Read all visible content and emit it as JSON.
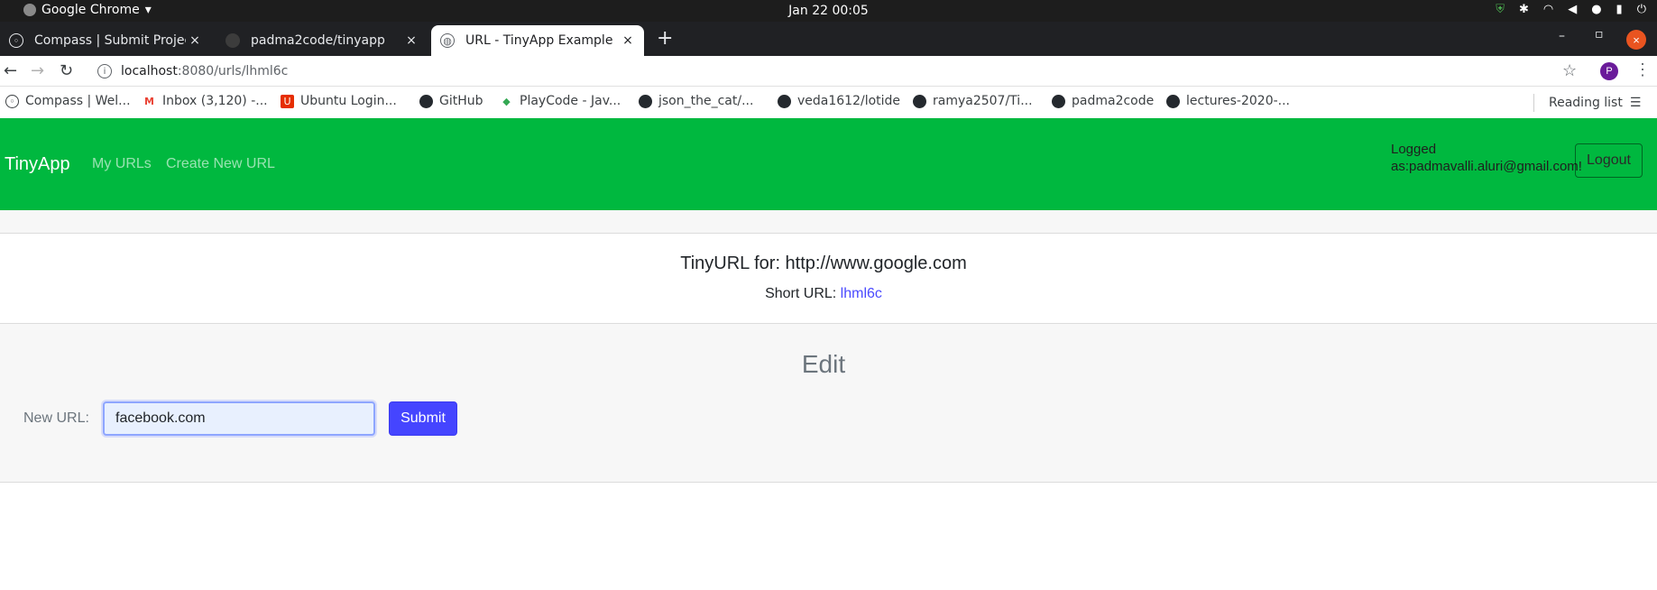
{
  "os": {
    "app_name": "Google Chrome",
    "app_menu_arrow": "▾",
    "clock": "Jan 22  00:05",
    "tray_icons": [
      "shield-icon",
      "slack-icon",
      "wifi-icon",
      "volume-icon",
      "mic-icon",
      "battery-icon",
      "power-icon"
    ]
  },
  "tabs": [
    {
      "title": "Compass | Submit Project",
      "icon": "compass-icon",
      "active": false
    },
    {
      "title": "padma2code/tinyapp",
      "icon": "github-icon",
      "active": false
    },
    {
      "title": "URL - TinyApp Example",
      "icon": "globe-icon",
      "active": true
    }
  ],
  "tab_close": "×",
  "new_tab": "+",
  "window": {
    "minimize": "–",
    "restore": "▫",
    "close": "×"
  },
  "address": {
    "host": "localhost",
    "path": ":8080/urls/lhml6c"
  },
  "profile_initial": "P",
  "bookmarks": [
    {
      "label": "Compass | Wel...",
      "icon": "compass-icon",
      "color": "#3c4043"
    },
    {
      "label": "Inbox (3,120) -...",
      "icon": "gmail-icon",
      "color": "#ea4335"
    },
    {
      "label": "Ubuntu Login...",
      "icon": "ubuntu-icon",
      "color": "#e62e00"
    },
    {
      "label": "GitHub",
      "icon": "github-icon",
      "color": "#24292e"
    },
    {
      "label": "PlayCode - Jav...",
      "icon": "playcode-icon",
      "color": "#34a853"
    },
    {
      "label": "json_the_cat/...",
      "icon": "github-icon",
      "color": "#24292e"
    },
    {
      "label": "veda1612/lotide",
      "icon": "github-icon",
      "color": "#24292e"
    },
    {
      "label": "ramya2507/Ti...",
      "icon": "github-icon",
      "color": "#24292e"
    },
    {
      "label": "padma2code",
      "icon": "github-icon",
      "color": "#24292e"
    },
    {
      "label": "lectures-2020-...",
      "icon": "github-icon",
      "color": "#24292e"
    }
  ],
  "reading_list": "Reading list",
  "app": {
    "brand": "TinyApp",
    "nav": [
      "My URLs",
      "Create New URL"
    ],
    "logged_in_line1": "Logged",
    "logged_in_line2": "as:padmavalli.aluri@gmail.com!",
    "logout": "Logout",
    "tinyurl_title": "TinyURL for: http://www.google.com",
    "short_url_label": "Short URL:",
    "short_url_value": "lhml6c",
    "edit_heading": "Edit",
    "new_url_label": "New URL:",
    "new_url_value": "facebook.com",
    "submit": "Submit",
    "accent_color": "#00b83f"
  }
}
